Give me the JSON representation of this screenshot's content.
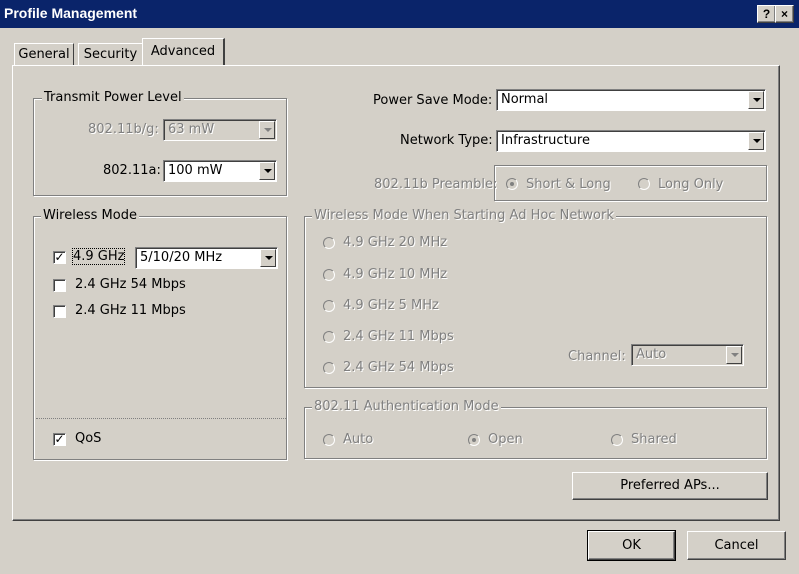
{
  "window": {
    "title": "Profile Management",
    "help_glyph": "?",
    "close_glyph": "×"
  },
  "tabs": [
    {
      "label": "General"
    },
    {
      "label": "Security"
    },
    {
      "label": "Advanced"
    }
  ],
  "transmit_power": {
    "legend": "Transmit Power Level",
    "bg_label": "802.11b/g:",
    "bg_value": "63 mW",
    "a_label": "802.11a:",
    "a_value": "100 mW"
  },
  "wireless_mode": {
    "legend": "Wireless Mode",
    "ghz49_label": "4.9 GHz",
    "ghz49_channel": "5/10/20 MHz",
    "ghz24_54_label": "2.4 GHz 54 Mbps",
    "ghz24_11_label": "2.4 GHz 11 Mbps",
    "qos_label": "QoS"
  },
  "power_save": {
    "label": "Power Save Mode:",
    "value": "Normal"
  },
  "network_type": {
    "label": "Network Type:",
    "value": "Infrastructure"
  },
  "preamble": {
    "label": "802.11b Preamble:",
    "opt1": "Short & Long",
    "opt2": "Long Only"
  },
  "adhoc": {
    "legend": "Wireless Mode When Starting Ad Hoc Network",
    "options": [
      "4.9 GHz 20 MHz",
      "4.9 GHz 10 MHz",
      "4.9 GHz 5 MHz",
      "2.4 GHz 11 Mbps",
      "2.4 GHz 54 Mbps"
    ],
    "channel_label": "Channel:",
    "channel_value": "Auto"
  },
  "auth": {
    "legend": "802.11 Authentication Mode",
    "opt_auto": "Auto",
    "opt_open": "Open",
    "opt_shared": "Shared"
  },
  "buttons": {
    "preferred_aps": "Preferred APs...",
    "ok": "OK",
    "cancel": "Cancel"
  }
}
